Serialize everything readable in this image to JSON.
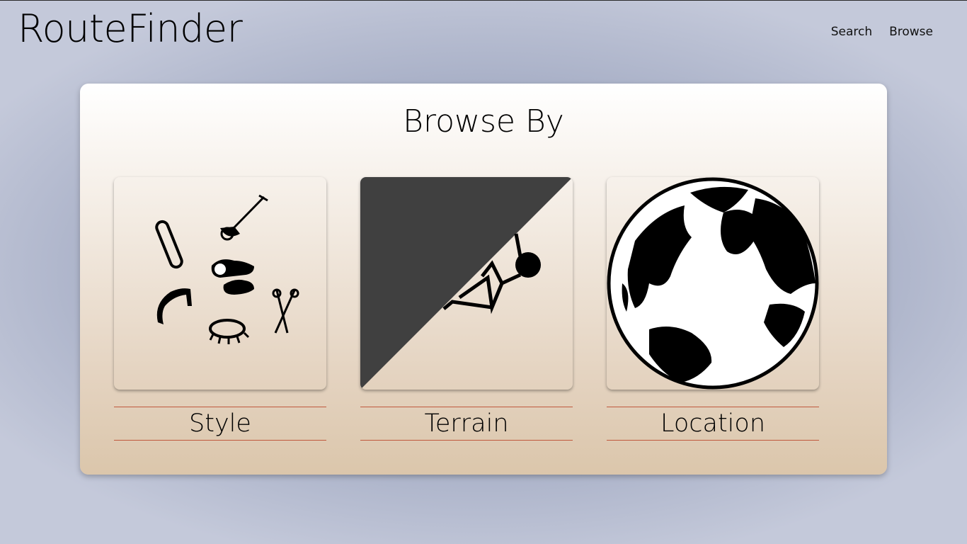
{
  "header": {
    "brand": "RouteFinder",
    "nav": [
      "Search",
      "Browse"
    ]
  },
  "panel": {
    "title": "Browse By",
    "categories": [
      {
        "label": "Style",
        "icon": "climbing-gear-icon"
      },
      {
        "label": "Terrain",
        "icon": "climber-on-wall-icon"
      },
      {
        "label": "Location",
        "icon": "globe-icon"
      }
    ]
  },
  "colors": {
    "label_rule": "#c0593e",
    "terrain_wall": "#404040"
  }
}
